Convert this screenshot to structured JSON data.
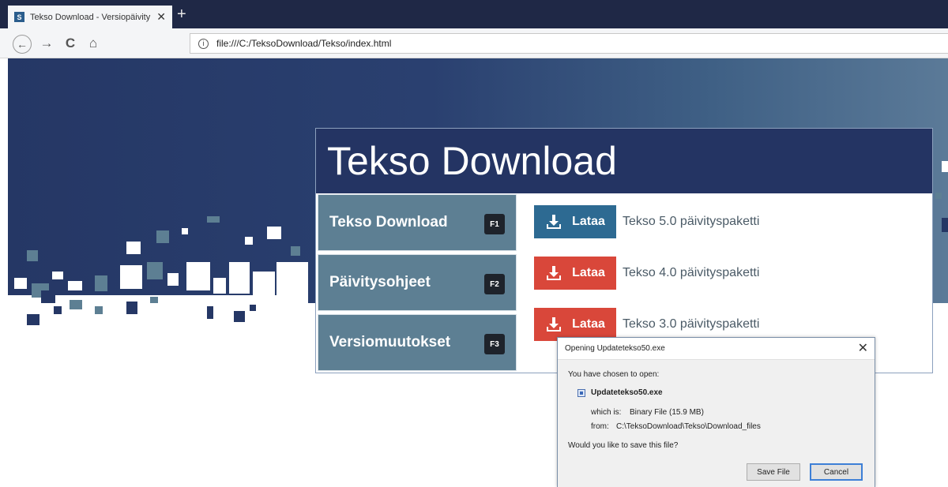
{
  "browser": {
    "tab_title": "Tekso Download - Versiopäivity",
    "tab_favicon_letter": "S",
    "tab_close": "✕",
    "new_tab": "+",
    "url": "file:///C:/TeksoDownload/Tekso/index.html",
    "icons": {
      "back": "←",
      "forward": "→",
      "reload": "C",
      "home": "⌂",
      "info": "i"
    }
  },
  "colors": {
    "hero": "#253765",
    "header": "#243463",
    "menu": "#5d7f93",
    "btn_blue": "#2d6a92",
    "btn_red": "#d9473a"
  },
  "panel": {
    "title": "Tekso Download",
    "menu": [
      {
        "label": "Tekso Download",
        "key": "F1"
      },
      {
        "label": "Päivitysohjeet",
        "key": "F2"
      },
      {
        "label": "Versiomuutokset",
        "key": "F3"
      }
    ],
    "downloads": [
      {
        "button": "Lataa",
        "text": "Tekso 5.0 päivityspaketti",
        "color": "#2d6a92"
      },
      {
        "button": "Lataa",
        "text": "Tekso 4.0 päivityspaketti",
        "color": "#d9473a"
      },
      {
        "button": "Lataa",
        "text": "Tekso 3.0 päivityspaketti",
        "color": "#d9473a"
      }
    ]
  },
  "dialog": {
    "title": "Opening Updatetekso50.exe",
    "close": "✕",
    "chosen": "You have chosen to open:",
    "filename": "Updatetekso50.exe",
    "which_label": "which is:",
    "which_value": "Binary File (15.9 MB)",
    "from_label": "from:",
    "from_value": "C:\\TeksoDownload\\Tekso\\Download_files",
    "question": "Would you like to save this file?",
    "save": "Save File",
    "cancel": "Cancel"
  }
}
